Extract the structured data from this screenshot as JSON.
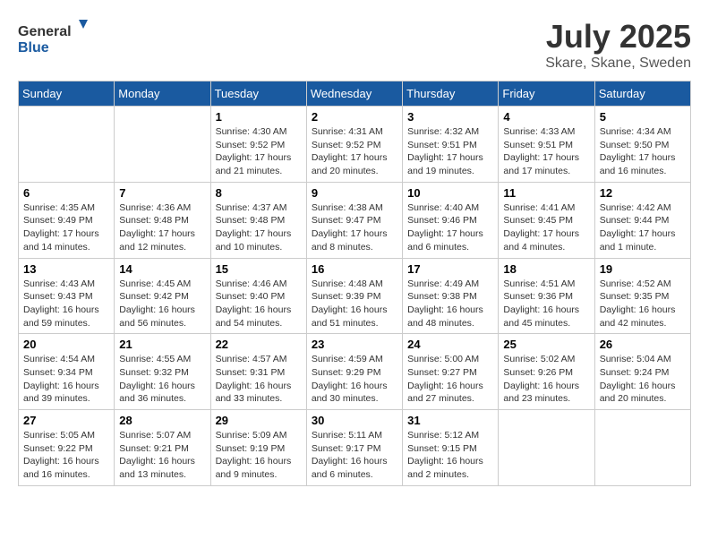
{
  "logo": {
    "text_general": "General",
    "text_blue": "Blue"
  },
  "title": {
    "month": "July 2025",
    "location": "Skare, Skane, Sweden"
  },
  "weekdays": [
    "Sunday",
    "Monday",
    "Tuesday",
    "Wednesday",
    "Thursday",
    "Friday",
    "Saturday"
  ],
  "weeks": [
    [
      {
        "day": "",
        "info": ""
      },
      {
        "day": "",
        "info": ""
      },
      {
        "day": "1",
        "info": "Sunrise: 4:30 AM\nSunset: 9:52 PM\nDaylight: 17 hours and 21 minutes."
      },
      {
        "day": "2",
        "info": "Sunrise: 4:31 AM\nSunset: 9:52 PM\nDaylight: 17 hours and 20 minutes."
      },
      {
        "day": "3",
        "info": "Sunrise: 4:32 AM\nSunset: 9:51 PM\nDaylight: 17 hours and 19 minutes."
      },
      {
        "day": "4",
        "info": "Sunrise: 4:33 AM\nSunset: 9:51 PM\nDaylight: 17 hours and 17 minutes."
      },
      {
        "day": "5",
        "info": "Sunrise: 4:34 AM\nSunset: 9:50 PM\nDaylight: 17 hours and 16 minutes."
      }
    ],
    [
      {
        "day": "6",
        "info": "Sunrise: 4:35 AM\nSunset: 9:49 PM\nDaylight: 17 hours and 14 minutes."
      },
      {
        "day": "7",
        "info": "Sunrise: 4:36 AM\nSunset: 9:48 PM\nDaylight: 17 hours and 12 minutes."
      },
      {
        "day": "8",
        "info": "Sunrise: 4:37 AM\nSunset: 9:48 PM\nDaylight: 17 hours and 10 minutes."
      },
      {
        "day": "9",
        "info": "Sunrise: 4:38 AM\nSunset: 9:47 PM\nDaylight: 17 hours and 8 minutes."
      },
      {
        "day": "10",
        "info": "Sunrise: 4:40 AM\nSunset: 9:46 PM\nDaylight: 17 hours and 6 minutes."
      },
      {
        "day": "11",
        "info": "Sunrise: 4:41 AM\nSunset: 9:45 PM\nDaylight: 17 hours and 4 minutes."
      },
      {
        "day": "12",
        "info": "Sunrise: 4:42 AM\nSunset: 9:44 PM\nDaylight: 17 hours and 1 minute."
      }
    ],
    [
      {
        "day": "13",
        "info": "Sunrise: 4:43 AM\nSunset: 9:43 PM\nDaylight: 16 hours and 59 minutes."
      },
      {
        "day": "14",
        "info": "Sunrise: 4:45 AM\nSunset: 9:42 PM\nDaylight: 16 hours and 56 minutes."
      },
      {
        "day": "15",
        "info": "Sunrise: 4:46 AM\nSunset: 9:40 PM\nDaylight: 16 hours and 54 minutes."
      },
      {
        "day": "16",
        "info": "Sunrise: 4:48 AM\nSunset: 9:39 PM\nDaylight: 16 hours and 51 minutes."
      },
      {
        "day": "17",
        "info": "Sunrise: 4:49 AM\nSunset: 9:38 PM\nDaylight: 16 hours and 48 minutes."
      },
      {
        "day": "18",
        "info": "Sunrise: 4:51 AM\nSunset: 9:36 PM\nDaylight: 16 hours and 45 minutes."
      },
      {
        "day": "19",
        "info": "Sunrise: 4:52 AM\nSunset: 9:35 PM\nDaylight: 16 hours and 42 minutes."
      }
    ],
    [
      {
        "day": "20",
        "info": "Sunrise: 4:54 AM\nSunset: 9:34 PM\nDaylight: 16 hours and 39 minutes."
      },
      {
        "day": "21",
        "info": "Sunrise: 4:55 AM\nSunset: 9:32 PM\nDaylight: 16 hours and 36 minutes."
      },
      {
        "day": "22",
        "info": "Sunrise: 4:57 AM\nSunset: 9:31 PM\nDaylight: 16 hours and 33 minutes."
      },
      {
        "day": "23",
        "info": "Sunrise: 4:59 AM\nSunset: 9:29 PM\nDaylight: 16 hours and 30 minutes."
      },
      {
        "day": "24",
        "info": "Sunrise: 5:00 AM\nSunset: 9:27 PM\nDaylight: 16 hours and 27 minutes."
      },
      {
        "day": "25",
        "info": "Sunrise: 5:02 AM\nSunset: 9:26 PM\nDaylight: 16 hours and 23 minutes."
      },
      {
        "day": "26",
        "info": "Sunrise: 5:04 AM\nSunset: 9:24 PM\nDaylight: 16 hours and 20 minutes."
      }
    ],
    [
      {
        "day": "27",
        "info": "Sunrise: 5:05 AM\nSunset: 9:22 PM\nDaylight: 16 hours and 16 minutes."
      },
      {
        "day": "28",
        "info": "Sunrise: 5:07 AM\nSunset: 9:21 PM\nDaylight: 16 hours and 13 minutes."
      },
      {
        "day": "29",
        "info": "Sunrise: 5:09 AM\nSunset: 9:19 PM\nDaylight: 16 hours and 9 minutes."
      },
      {
        "day": "30",
        "info": "Sunrise: 5:11 AM\nSunset: 9:17 PM\nDaylight: 16 hours and 6 minutes."
      },
      {
        "day": "31",
        "info": "Sunrise: 5:12 AM\nSunset: 9:15 PM\nDaylight: 16 hours and 2 minutes."
      },
      {
        "day": "",
        "info": ""
      },
      {
        "day": "",
        "info": ""
      }
    ]
  ]
}
